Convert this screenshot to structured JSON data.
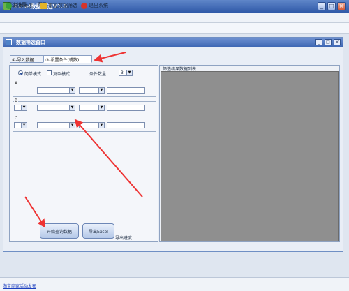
{
  "window": {
    "title": "Excel数据筛选V1.0"
  },
  "menu": [
    "筛选设置",
    "帮助"
  ],
  "toolbar": [
    {
      "label": "数据筛选",
      "icon": "filter-icon"
    },
    {
      "label": "重复数据筛选",
      "icon": "duplicate-icon"
    },
    {
      "label": "退出系统",
      "icon": "exit-icon"
    }
  ],
  "inner_window": {
    "title": "数据筛选窗口"
  },
  "tabs": [
    {
      "label": "①-导入数据"
    },
    {
      "label": "②-设置条件(或数)"
    }
  ],
  "left": {
    "radio1": "简单模式",
    "radio2": "复杂模式",
    "condition_label": "条件数量：",
    "condition_value": "3",
    "groups": [
      "A",
      "B",
      "C"
    ]
  },
  "right": {
    "title": "筛选结果数据列表"
  },
  "buttons": {
    "start": "开始查询数据",
    "export": "导出Excel",
    "progress": "导出进度："
  },
  "status": {
    "link": "淘宝商家活动发布"
  }
}
